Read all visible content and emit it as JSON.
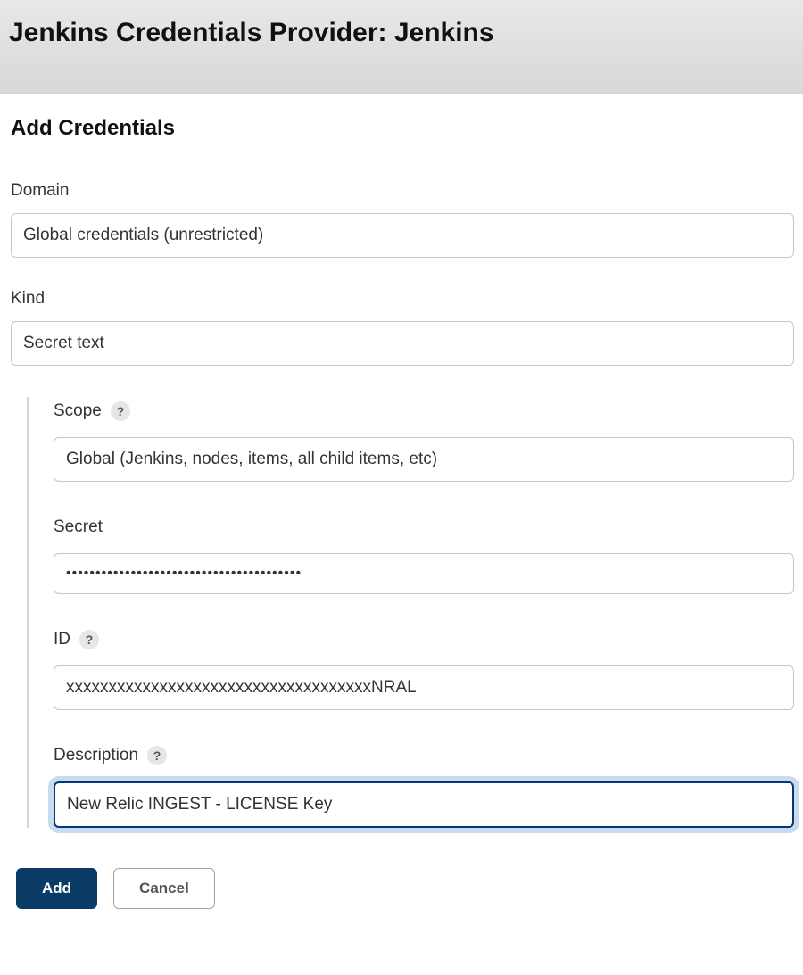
{
  "header": {
    "title": "Jenkins Credentials Provider: Jenkins"
  },
  "section_title": "Add Credentials",
  "fields": {
    "domain": {
      "label": "Domain",
      "value": "Global credentials (unrestricted)"
    },
    "kind": {
      "label": "Kind",
      "value": "Secret text"
    },
    "scope": {
      "label": "Scope",
      "value": "Global (Jenkins, nodes, items, all child items, etc)"
    },
    "secret": {
      "label": "Secret",
      "value": "••••••••••••••••••••••••••••••••••••••••"
    },
    "id": {
      "label": "ID",
      "value": "xxxxxxxxxxxxxxxxxxxxxxxxxxxxxxxxxxxxNRAL"
    },
    "description": {
      "label": "Description",
      "value": "New Relic INGEST - LICENSE Key"
    }
  },
  "buttons": {
    "add": "Add",
    "cancel": "Cancel"
  },
  "help_symbol": "?"
}
